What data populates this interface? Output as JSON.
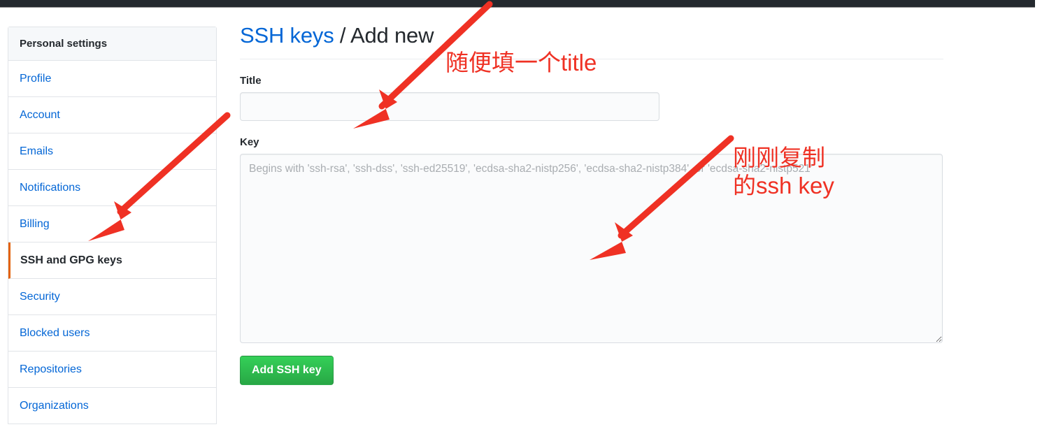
{
  "window": {
    "topbar_color": "#24292e",
    "accent_link_color": "#0366d6",
    "active_marker_color": "#e36209",
    "annotation_color": "#ef3124",
    "button_color": "#2cbe4e"
  },
  "sidebar": {
    "header": "Personal settings",
    "items": [
      {
        "label": "Profile",
        "selected": false
      },
      {
        "label": "Account",
        "selected": false
      },
      {
        "label": "Emails",
        "selected": false
      },
      {
        "label": "Notifications",
        "selected": false
      },
      {
        "label": "Billing",
        "selected": false
      },
      {
        "label": "SSH and GPG keys",
        "selected": true
      },
      {
        "label": "Security",
        "selected": false
      },
      {
        "label": "Blocked users",
        "selected": false
      },
      {
        "label": "Repositories",
        "selected": false
      },
      {
        "label": "Organizations",
        "selected": false
      }
    ]
  },
  "main": {
    "title_link": "SSH keys",
    "title_rest": " / Add new",
    "title_label": "Title",
    "title_value": "",
    "title_placeholder": "",
    "key_label": "Key",
    "key_value": "",
    "key_placeholder": "Begins with 'ssh-rsa', 'ssh-dss', 'ssh-ed25519', 'ecdsa-sha2-nistp256', 'ecdsa-sha2-nistp384', or 'ecdsa-sha2-nistp521'",
    "submit_label": "Add SSH key"
  },
  "annotations": {
    "title_note": "随便填一个title",
    "key_note": "刚刚复制\n的ssh key"
  }
}
